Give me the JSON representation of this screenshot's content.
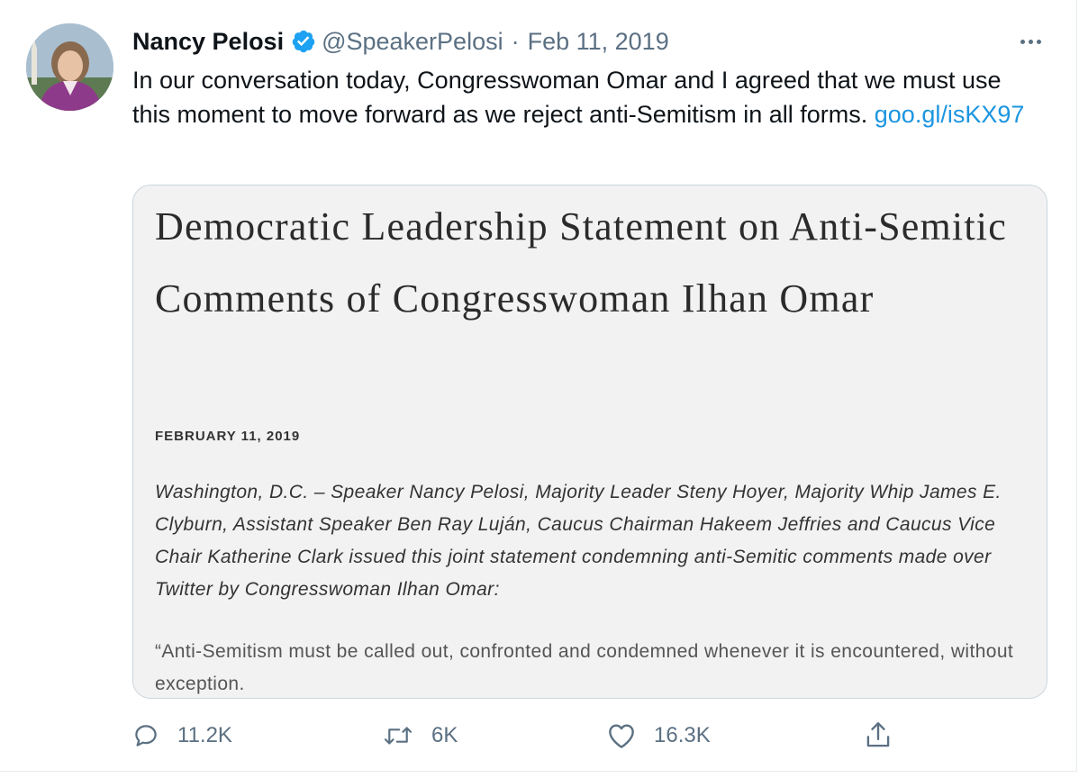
{
  "author": {
    "name": "Nancy Pelosi",
    "handle": "@SpeakerPelosi",
    "separator": "·",
    "date": "Feb 11, 2019",
    "verified_color": "#1da1f2"
  },
  "tweet": {
    "text": "In our conversation today, Congresswoman Omar and I agreed that we must use this moment to move forward as we reject anti-Semitism in all forms. ",
    "link": "goo.gl/isKX97",
    "link_color": "#1b95e0"
  },
  "card": {
    "title": "Democratic Leadership Statement on Anti-Semitic Comments of Congresswoman Ilhan Omar",
    "date": "FEBRUARY 11, 2019",
    "body": "Washington, D.C. – Speaker Nancy Pelosi, Majority Leader Steny Hoyer, Majority Whip James E. Clyburn, Assistant Speaker Ben Ray Luján, Caucus Chairman Hakeem Jeffries and Caucus Vice Chair Katherine Clark issued this joint statement condemning anti-Semitic comments made over Twitter by Congresswoman Ilhan Omar:",
    "quote": "“Anti-Semitism must be called out, confronted and condemned whenever it is encountered, without exception."
  },
  "actions": {
    "reply_icon": "reply-icon",
    "reply_count": "11.2K",
    "retweet_icon": "retweet-icon",
    "retweet_count": "6K",
    "like_icon": "heart-icon",
    "like_count": "16.3K",
    "share_icon": "share-icon"
  },
  "menu": {
    "icon": "more-icon"
  }
}
